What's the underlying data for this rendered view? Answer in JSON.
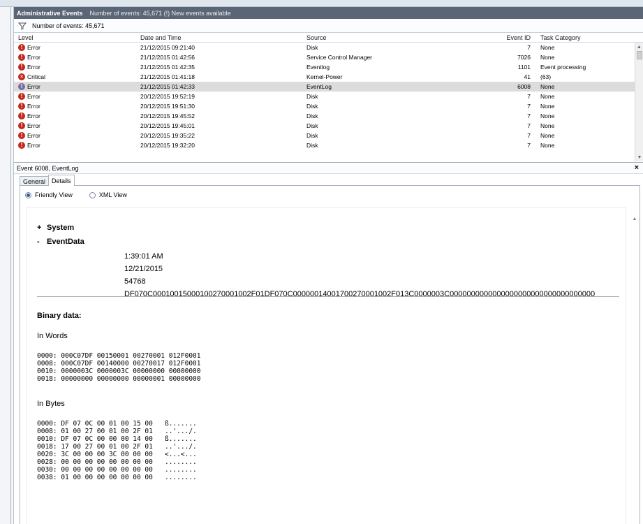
{
  "titlebar": {
    "title": "Administrative Events",
    "info": "Number of events: 45,671 (!) New events available"
  },
  "filterbar": {
    "label": "Number of events: 45,671"
  },
  "grid": {
    "columns": [
      "Level",
      "Date and Time",
      "Source",
      "Event ID",
      "Task Category"
    ],
    "rows": [
      {
        "level": "Error",
        "date": "21/12/2015 09:21:40",
        "source": "Disk",
        "id": "7",
        "cat": "None"
      },
      {
        "level": "Error",
        "date": "21/12/2015 01:42:56",
        "source": "Service Control Manager",
        "id": "7026",
        "cat": "None"
      },
      {
        "level": "Error",
        "date": "21/12/2015 01:42:35",
        "source": "Eventlog",
        "id": "1101",
        "cat": "Event processing"
      },
      {
        "level": "Critical",
        "date": "21/12/2015 01:41:18",
        "source": "Kernel-Power",
        "id": "41",
        "cat": "(63)"
      },
      {
        "level": "Error",
        "date": "21/12/2015 01:42:33",
        "source": "EventLog",
        "id": "6008",
        "cat": "None"
      },
      {
        "level": "Error",
        "date": "20/12/2015 19:52:19",
        "source": "Disk",
        "id": "7",
        "cat": "None"
      },
      {
        "level": "Error",
        "date": "20/12/2015 19:51:30",
        "source": "Disk",
        "id": "7",
        "cat": "None"
      },
      {
        "level": "Error",
        "date": "20/12/2015 19:45:52",
        "source": "Disk",
        "id": "7",
        "cat": "None"
      },
      {
        "level": "Error",
        "date": "20/12/2015 19:45:01",
        "source": "Disk",
        "id": "7",
        "cat": "None"
      },
      {
        "level": "Error",
        "date": "20/12/2015 19:35:22",
        "source": "Disk",
        "id": "7",
        "cat": "None"
      },
      {
        "level": "Error",
        "date": "20/12/2015 19:32:20",
        "source": "Disk",
        "id": "7",
        "cat": "None"
      }
    ],
    "selected_index": 4
  },
  "detail": {
    "title": "Event 6008, EventLog",
    "close": "×",
    "tabs": [
      "General",
      "Details"
    ],
    "active_tab": "Details",
    "view_friendly": "Friendly View",
    "view_xml": "XML View",
    "tree": {
      "system_sign": "+",
      "system_label": "System",
      "eventdata_sign": "-",
      "eventdata_label": "EventData"
    },
    "eventdata": [
      "1:39:01 AM",
      "12/21/2015",
      "54768",
      "DF070C000100150001002700010​02F01DF070C00000014001700270001002F013C0000003C0000000000000000000000000000000000"
    ],
    "binary_title": "Binary data:",
    "in_words_label": "In Words",
    "words": "0000: 000C07DF 00150001 00270001 012F0001\n0008: 000C07DF 00140000 00270017 012F0001\n0010: 0000003C 0000003C 00000000 00000000\n0018: 00000000 00000000 00000001 00000000",
    "in_bytes_label": "In Bytes",
    "bytes": "0000: DF 07 0C 00 01 00 15 00   ß.......\n0008: 01 00 27 00 01 00 2F 01   ..'.../.\n0010: DF 07 0C 00 00 00 14 00   ß.......\n0018: 17 00 27 00 01 00 2F 01   ..'.../.\n0020: 3C 00 00 00 3C 00 00 00   <...<...\n0028: 00 00 00 00 00 00 00 00   ........\n0030: 00 00 00 00 00 00 00 00   ........\n0038: 01 00 00 00 00 00 00 00   ........"
  },
  "colors": {
    "error_icon": "#c4271c",
    "titlebar_bg": "#5a6575",
    "selected_row": "#dcdcdc"
  }
}
